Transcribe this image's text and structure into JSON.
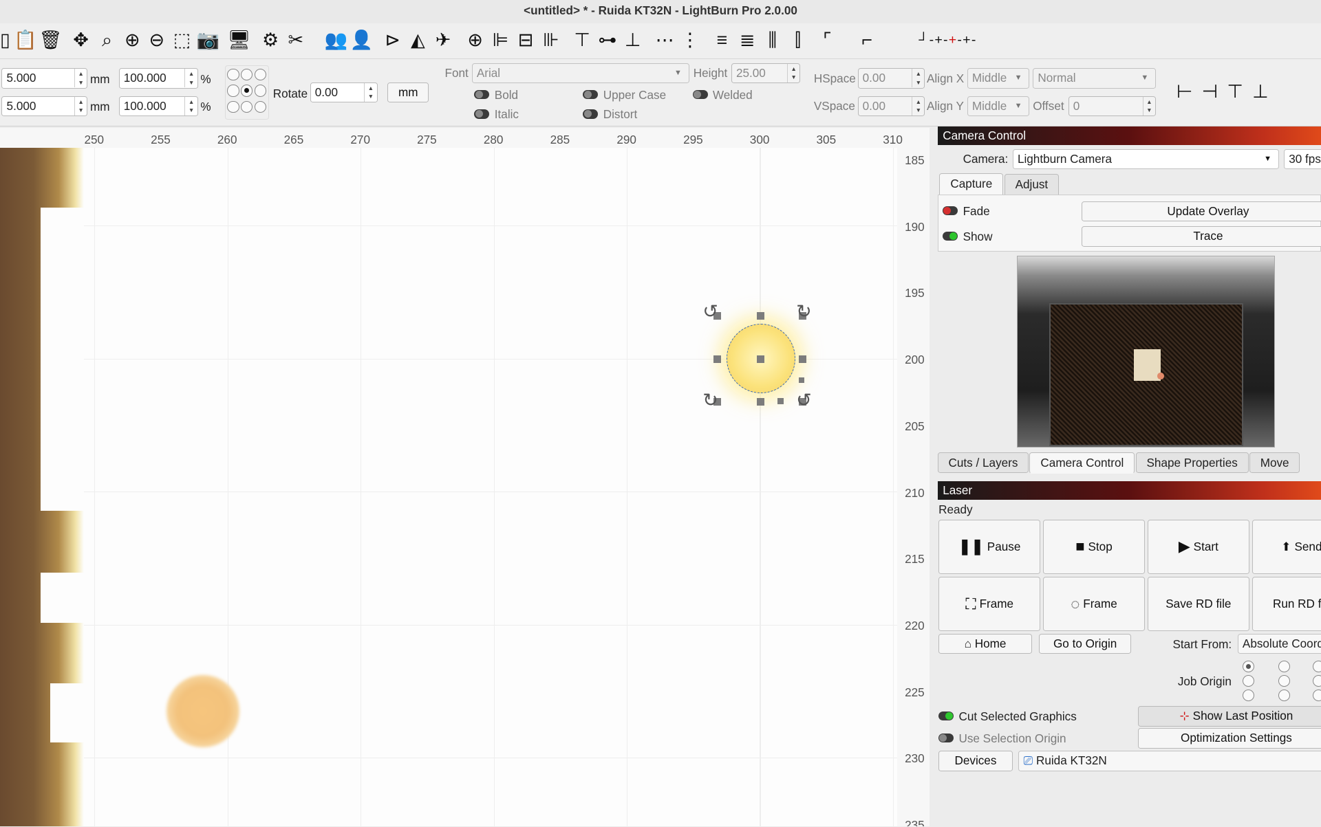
{
  "window": {
    "title": "<untitled> * - Ruida KT32N - LightBurn Pro 2.0.00"
  },
  "toolbar_icons": [
    "new-file-icon",
    "paste-icon",
    "delete-icon",
    "move-icon",
    "zoom-icon",
    "zoom-in-icon",
    "zoom-out-icon",
    "zoom-selection-icon",
    "camera-capture-icon",
    "monitor-icon",
    "settings-icon",
    "tools-icon",
    "group-icon",
    "user-icon",
    "send-icon",
    "mirror-icon",
    "send-path-icon",
    "target-icon",
    "align-left-icon",
    "align-center-icon",
    "align-right-icon",
    "align-top-icon",
    "align-middle-icon",
    "align-bottom-icon",
    "distribute-h-icon",
    "distribute-v-icon",
    "space-h-icon",
    "space-v-icon",
    "move-together-icon",
    "bracket-icon",
    "step-icon",
    "origin-icon",
    "marker-icon"
  ],
  "shape": {
    "x": "5.000",
    "y": "5.000",
    "unit1": "mm",
    "unit2": "mm",
    "w_pct": "100.000",
    "h_pct": "100.000",
    "pct_sym1": "%",
    "pct_sym2": "%",
    "rotate_label": "Rotate",
    "rotate": "0.00",
    "unit_button": "mm"
  },
  "text": {
    "font_label": "Font",
    "font": "Arial",
    "height_label": "Height",
    "height": "25.00",
    "hspace_label": "HSpace",
    "hspace": "0.00",
    "vspace_label": "VSpace",
    "vspace": "0.00",
    "alignx_label": "Align X",
    "alignx": "Middle",
    "aligny_label": "Align Y",
    "aligny": "Middle",
    "style": "Normal",
    "offset_label": "Offset",
    "offset": "0",
    "bold": "Bold",
    "italic": "Italic",
    "upper": "Upper Case",
    "distort": "Distort",
    "welded": "Welded"
  },
  "ruler": {
    "top": [
      "250",
      "255",
      "260",
      "265",
      "270",
      "275",
      "280",
      "285",
      "290",
      "295",
      "300",
      "305",
      "310"
    ],
    "right": [
      "185",
      "190",
      "195",
      "200",
      "205",
      "210",
      "215",
      "220",
      "225",
      "230",
      "235"
    ]
  },
  "camera": {
    "header": "Camera Control",
    "camera_label": "Camera:",
    "camera": "Lightburn Camera",
    "fps": "30 fps",
    "tab_capture": "Capture",
    "tab_adjust": "Adjust",
    "fade": "Fade",
    "show": "Show",
    "update_overlay": "Update Overlay",
    "trace": "Trace"
  },
  "panel_tabs": [
    "Cuts / Layers",
    "Camera Control",
    "Shape Properties",
    "Move"
  ],
  "laser": {
    "header": "Laser",
    "status": "Ready",
    "pause": "Pause",
    "stop": "Stop",
    "start": "Start",
    "send": "Send",
    "frame1": "Frame",
    "frame2": "Frame",
    "save_rd": "Save RD file",
    "run_rd": "Run RD file",
    "home": "Home",
    "go_origin": "Go to Origin",
    "start_from_label": "Start From:",
    "start_from": "Absolute Coords",
    "job_origin_label": "Job Origin",
    "cut_selected": "Cut Selected Graphics",
    "use_selection_origin": "Use Selection Origin",
    "show_last_position": "Show Last Position",
    "optimization": "Optimization Settings",
    "devices": "Devices",
    "device": "Ruida KT32N"
  }
}
